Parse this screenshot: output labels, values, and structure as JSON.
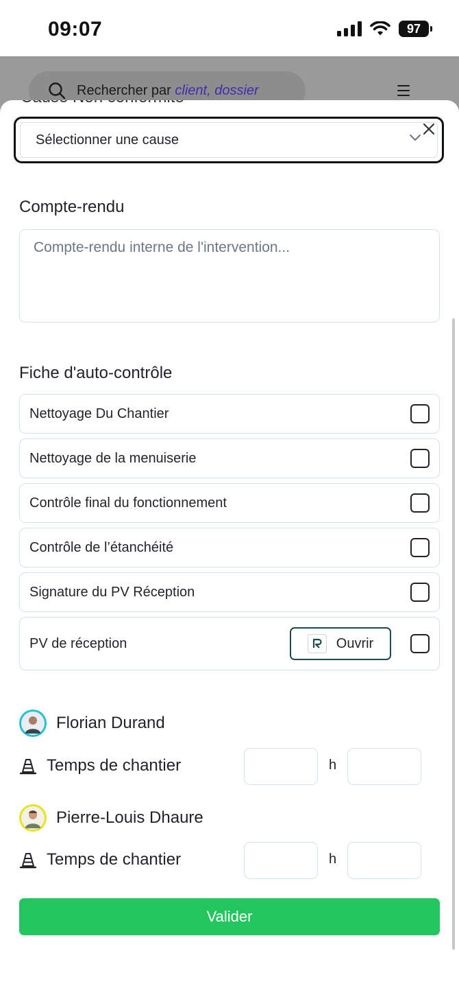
{
  "status_bar": {
    "time": "09:07",
    "battery": "97"
  },
  "header": {
    "search_prefix": "Rechercher par ",
    "search_emphasis": "client, dossier"
  },
  "form": {
    "cause_label_partial": "Cause Non conformité",
    "cause_select_value": "Sélectionner une cause",
    "report_label": "Compte-rendu",
    "report_placeholder": "Compte-rendu interne de l'intervention...",
    "checklist_label": "Fiche d'auto-contrôle",
    "checklist": [
      {
        "label": "Nettoyage Du Chantier",
        "checked": false
      },
      {
        "label": "Nettoyage de la menuiserie",
        "checked": false
      },
      {
        "label": "Contrôle final du fonctionnement",
        "checked": false
      },
      {
        "label": "Contrôle de l’étanchéité",
        "checked": false
      },
      {
        "label": "Signature du PV Réception",
        "checked": false
      },
      {
        "label": "PV de réception",
        "checked": false,
        "action_label": "Ouvrir"
      }
    ],
    "technicians": [
      {
        "name": "Florian Durand",
        "time_label": "Temps de chantier",
        "hours": "",
        "minutes": "",
        "unit": "h",
        "avatar_ring": "#25c0d6"
      },
      {
        "name": "Pierre-Louis Dhaure",
        "time_label": "Temps de chantier",
        "hours": "",
        "minutes": "",
        "unit": "h",
        "avatar_ring": "#e3e61e"
      }
    ],
    "submit_label": "Valider"
  },
  "colors": {
    "accent_green": "#22c55e",
    "border": "#d6e2ec",
    "search_emphasis": "#3b2fb0"
  }
}
